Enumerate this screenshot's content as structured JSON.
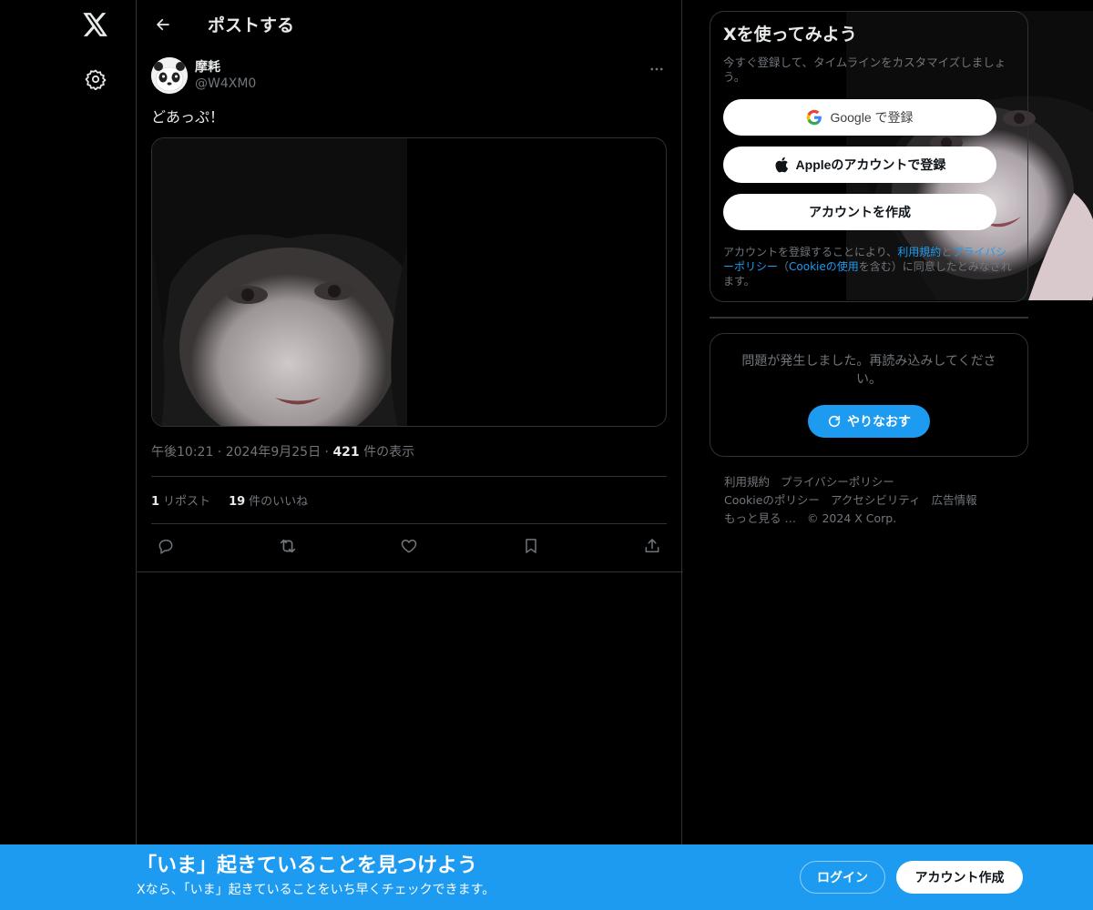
{
  "header": {
    "title": "ポストする"
  },
  "post": {
    "author_name": "摩耗",
    "author_handle": "@W4XM0",
    "text": "どあっぷ！",
    "time": "午後10:21",
    "date": "2024年9月25日",
    "views_count": "421",
    "views_label": "件の表示",
    "reposts_count": "1",
    "reposts_label": "リポスト",
    "likes_count": "19",
    "likes_label": "件のいいね"
  },
  "signup": {
    "title": "Xを使ってみよう",
    "subtitle": "今すぐ登録して、タイムラインをカスタマイズしましょう。",
    "google_label": "Google で登録",
    "apple_label": "Appleのアカウントで登録",
    "create_label": "アカウントを作成",
    "legal_prefix": "アカウントを登録することにより、",
    "legal_terms": "利用規約",
    "legal_and": "と",
    "legal_privacy": "プライバシーポリシー",
    "legal_paren_open": "（",
    "legal_cookie": "Cookieの使用",
    "legal_suffix": "を含む）に同意したとみなされます。"
  },
  "error": {
    "text": "問題が発生しました。再読み込みしてください。",
    "retry_label": "やりなおす"
  },
  "footer": {
    "links": [
      "利用規約",
      "プライバシーポリシー",
      "Cookieのポリシー",
      "アクセシビリティ",
      "広告情報",
      "もっと見る …",
      "© 2024 X Corp."
    ]
  },
  "banner": {
    "title": "「いま」起きていることを見つけよう",
    "subtitle": "Xなら、「いま」起きていることをいち早くチェックできます。",
    "login_label": "ログイン",
    "create_label": "アカウント作成"
  },
  "colors": {
    "accent": "#1d9bf0",
    "background": "#000000",
    "border": "#2f3336",
    "muted_text": "#71767b"
  }
}
